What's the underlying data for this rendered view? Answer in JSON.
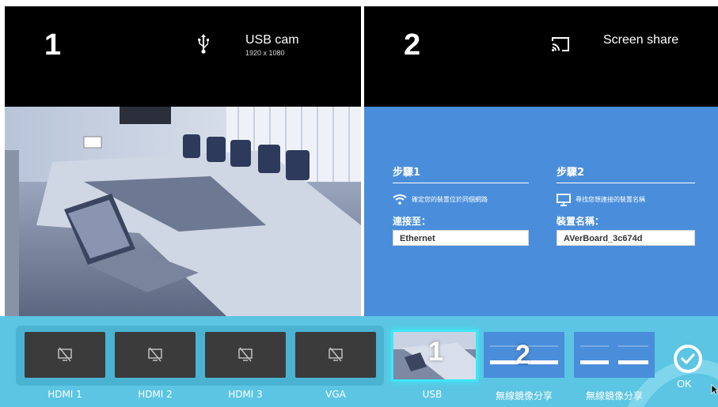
{
  "panes": [
    {
      "number": "1",
      "icon": "usb-icon",
      "title": "USB cam",
      "subtitle": "1920 x 1080"
    },
    {
      "number": "2",
      "icon": "cast-icon",
      "title": "Screen share"
    }
  ],
  "screen_share": {
    "step1": {
      "title": "步驟1",
      "note": "確定您的裝置位於同個網路",
      "label": "連接至：",
      "value": "Ethernet"
    },
    "step2": {
      "title": "步驟2",
      "note": "尋找您想連接的裝置名稱",
      "label": "裝置名稱：",
      "value": "AVerBoard_3c674d"
    }
  },
  "sources": [
    {
      "label": "HDMI 1",
      "icon": "no-signal-icon"
    },
    {
      "label": "HDMI 2",
      "icon": "no-signal-icon"
    },
    {
      "label": "HDMI 3",
      "icon": "no-signal-icon"
    },
    {
      "label": "VGA",
      "icon": "no-signal-icon"
    },
    {
      "label": "USB",
      "badge": "1",
      "selected": true
    },
    {
      "label": "無線鏡像分享",
      "badge": "2"
    },
    {
      "label": "無線鏡像分享"
    }
  ],
  "ok_label": "OK",
  "colors": {
    "panel_blue": "#4a8edb",
    "bar": "#5bc5e3",
    "selected_border": "#3fe6f5"
  }
}
